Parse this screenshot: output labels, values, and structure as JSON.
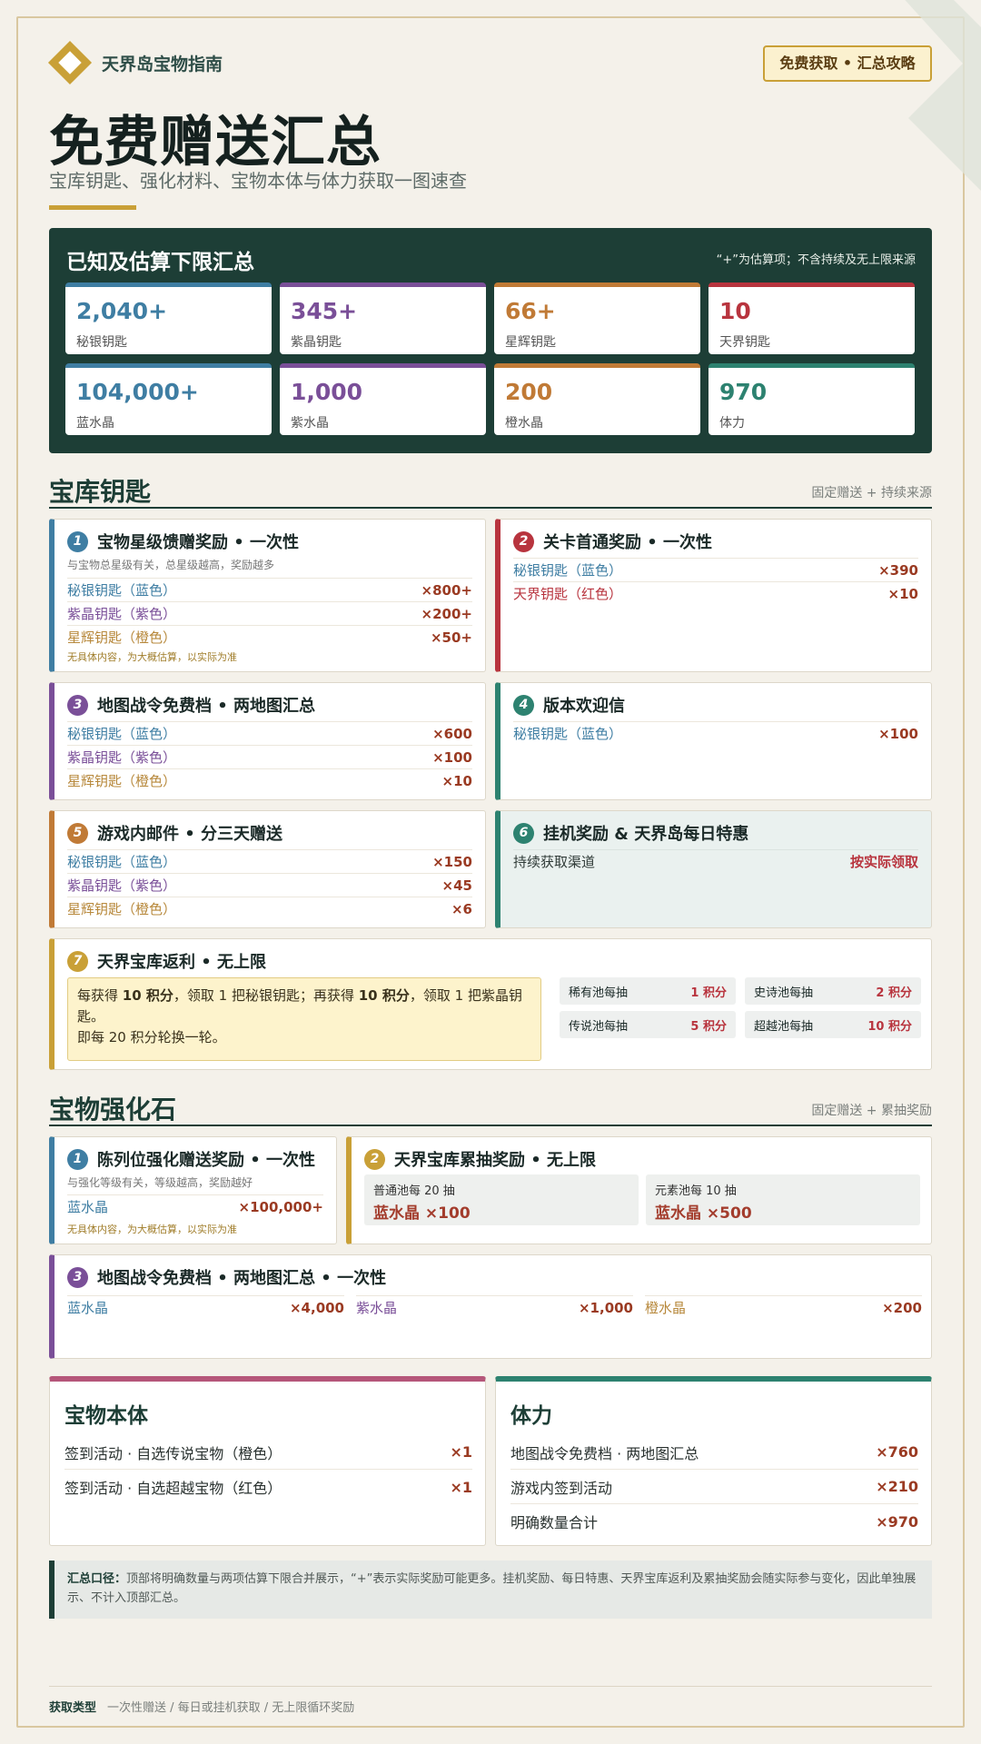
{
  "header": {
    "brand": "天界岛宝物指南",
    "badge": "免费获取 • 汇总攻略",
    "title": "免费赠送汇总",
    "subtitle": "宝库钥匙、强化材料、宝物本体与体力获取一图速查"
  },
  "summary": {
    "title": "已知及估算下限汇总",
    "note": "“+”为估算项；不含持续及无上限来源",
    "stats": [
      {
        "value": "2,040+",
        "label": "秘银钥匙",
        "color": "#3f7ea3"
      },
      {
        "value": "345+",
        "label": "紫晶钥匙",
        "color": "#7a4f98"
      },
      {
        "value": "66+",
        "label": "星辉钥匙",
        "color": "#c07a36"
      },
      {
        "value": "10",
        "label": "天界钥匙",
        "color": "#b8343e"
      },
      {
        "value": "104,000+",
        "label": "蓝水晶",
        "color": "#3f7ea3"
      },
      {
        "value": "1,000",
        "label": "紫水晶",
        "color": "#7a4f98"
      },
      {
        "value": "200",
        "label": "橙水晶",
        "color": "#c07a36"
      },
      {
        "value": "970",
        "label": "体力",
        "color": "#2d8270"
      }
    ]
  },
  "keys": {
    "heading": "宝库钥匙",
    "note": "固定赠送 + 持续来源",
    "c1": {
      "num": "1",
      "title": "宝物星级馈赠奖励 • 一次性",
      "desc": "与宝物总星级有关，总星级越高，奖励越多",
      "rows": [
        {
          "label": "秘银钥匙（蓝色）",
          "qty": "×800+"
        },
        {
          "label": "紫晶钥匙（紫色）",
          "qty": "×200+"
        },
        {
          "label": "星辉钥匙（橙色）",
          "qty": "×50+"
        }
      ],
      "foot": "无具体内容，为大概估算，以实际为准"
    },
    "c2": {
      "num": "2",
      "title": "关卡首通奖励 • 一次性",
      "rows": [
        {
          "label": "秘银钥匙（蓝色）",
          "qty": "×390"
        },
        {
          "label": "天界钥匙（红色）",
          "qty": "×10"
        }
      ]
    },
    "c3": {
      "num": "3",
      "title": "地图战令免费档 • 两地图汇总",
      "rows": [
        {
          "label": "秘银钥匙（蓝色）",
          "qty": "×600"
        },
        {
          "label": "紫晶钥匙（紫色）",
          "qty": "×100"
        },
        {
          "label": "星辉钥匙（橙色）",
          "qty": "×10"
        }
      ]
    },
    "c4": {
      "num": "4",
      "title": "版本欢迎信",
      "rows": [
        {
          "label": "秘银钥匙（蓝色）",
          "qty": "×100"
        }
      ]
    },
    "c5": {
      "num": "5",
      "title": "游戏内邮件 • 分三天赠送",
      "rows": [
        {
          "label": "秘银钥匙（蓝色）",
          "qty": "×150"
        },
        {
          "label": "紫晶钥匙（紫色）",
          "qty": "×45"
        },
        {
          "label": "星辉钥匙（橙色）",
          "qty": "×6"
        }
      ]
    },
    "c6": {
      "num": "6",
      "title": "挂机奖励 & 天界岛每日特惠",
      "rows": [
        {
          "label": "持续获取渠道",
          "qty": "按实际领取"
        }
      ]
    },
    "c7": {
      "num": "7",
      "title": "天界宝库返利 • 无上限",
      "text_a": "每获得 ",
      "pts_a": "10 积分",
      "text_b": "，领取 1 把秘银钥匙；再获得 ",
      "pts_b": "10 积分",
      "text_c": "，领取 1 把紫晶钥匙。",
      "text_d": "即每 20 积分轮换一轮。",
      "points": [
        {
          "label": "稀有池每抽",
          "pts": "1 积分"
        },
        {
          "label": "史诗池每抽",
          "pts": "2 积分"
        },
        {
          "label": "传说池每抽",
          "pts": "5 积分"
        },
        {
          "label": "超越池每抽",
          "pts": "10 积分"
        }
      ]
    }
  },
  "stones": {
    "heading": "宝物强化石",
    "note": "固定赠送 + 累抽奖励",
    "c1": {
      "num": "1",
      "title": "陈列位强化赠送奖励 • 一次性",
      "desc": "与强化等级有关，等级越高，奖励越好",
      "rows": [
        {
          "label": "蓝水晶",
          "qty": "×100,000+"
        }
      ],
      "foot": "无具体内容，为大概估算，以实际为准"
    },
    "c2": {
      "num": "2",
      "title": "天界宝库累抽奖励 • 无上限",
      "pools": [
        {
          "cond": "普通池每 20 抽",
          "reward": "蓝水晶 ×100"
        },
        {
          "cond": "元素池每 10 抽",
          "reward": "蓝水晶 ×500"
        }
      ]
    },
    "c3": {
      "num": "3",
      "title": "地图战令免费档 • 两地图汇总 • 一次性",
      "cols": [
        {
          "label": "蓝水晶",
          "qty": "×4,000"
        },
        {
          "label": "紫水晶",
          "qty": "×1,000"
        },
        {
          "label": "橙水晶",
          "qty": "×200"
        }
      ]
    }
  },
  "treasure": {
    "title": "宝物本体",
    "rows": [
      {
        "label": "签到活动 · 自选传说宝物（橙色）",
        "qty": "×1"
      },
      {
        "label": "签到活动 · 自选超越宝物（红色）",
        "qty": "×1"
      }
    ]
  },
  "stamina": {
    "title": "体力",
    "rows": [
      {
        "label": "地图战令免费档 · 两地图汇总",
        "qty": "×760"
      },
      {
        "label": "游戏内签到活动",
        "qty": "×210"
      },
      {
        "label": "明确数量合计",
        "qty": "×970"
      }
    ]
  },
  "note": {
    "label": "汇总口径：",
    "text": "顶部将明确数量与两项估算下限合并展示，“+”表示实际奖励可能更多。挂机奖励、每日特惠、天界宝库返利及累抽奖励会随实际参与变化，因此单独展示、不计入顶部汇总。"
  },
  "footer": {
    "label": "获取类型",
    "text": "一次性赠送 / 每日或挂机获取 / 无上限循环奖励"
  }
}
